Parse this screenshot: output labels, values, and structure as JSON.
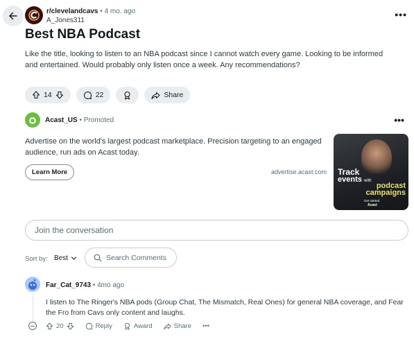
{
  "post": {
    "subreddit": "r/clevelandcavs",
    "separator": "•",
    "age": "4 mo. ago",
    "author": "A_Jones311",
    "more": "•••",
    "title": "Best NBA Podcast",
    "body": "Like the title, looking to listen to an NBA podcast since I cannot watch every game. Looking to be informed and entertained. Would probably only listen once a week. Any recommendations?",
    "upvotes": "14",
    "comments": "22",
    "share_label": "Share"
  },
  "ad": {
    "advertiser": "Acast_US",
    "separator": "•",
    "promoted_label": "Promoted",
    "more": "•••",
    "text": "Advertise on the world's largest podcast marketplace. Precision targeting to an engaged audience, run ads on Acast today.",
    "cta_label": "Learn More",
    "domain": "advertise.acast.com",
    "image": {
      "line1": "Track",
      "line2": "events",
      "line2_small": "with",
      "line3a": "podcast",
      "line3b": "campaigns",
      "small1": "Get started",
      "small2": "Acast"
    }
  },
  "join": {
    "placeholder": "Join the conversation"
  },
  "sort": {
    "label": "Sort by:",
    "value": "Best"
  },
  "search": {
    "placeholder": "Search Comments"
  },
  "comment": {
    "author": "Far_Cat_9743",
    "separator": "•",
    "age": "4mo ago",
    "text": "I listen to The Ringer's NBA pods (Group Chat, The Mismatch, Real Ones) for general NBA coverage, and Fear the Fro from Cavs only content and laughs.",
    "upvotes": "20",
    "reply_label": "Reply",
    "award_label": "Award",
    "share_label": "Share",
    "more": "•••"
  },
  "colors": {
    "pill_bg": "#eaedef",
    "text_secondary": "#576f76",
    "cavs_wine": "#3b0a12",
    "acast_green": "#6bbf3e"
  }
}
